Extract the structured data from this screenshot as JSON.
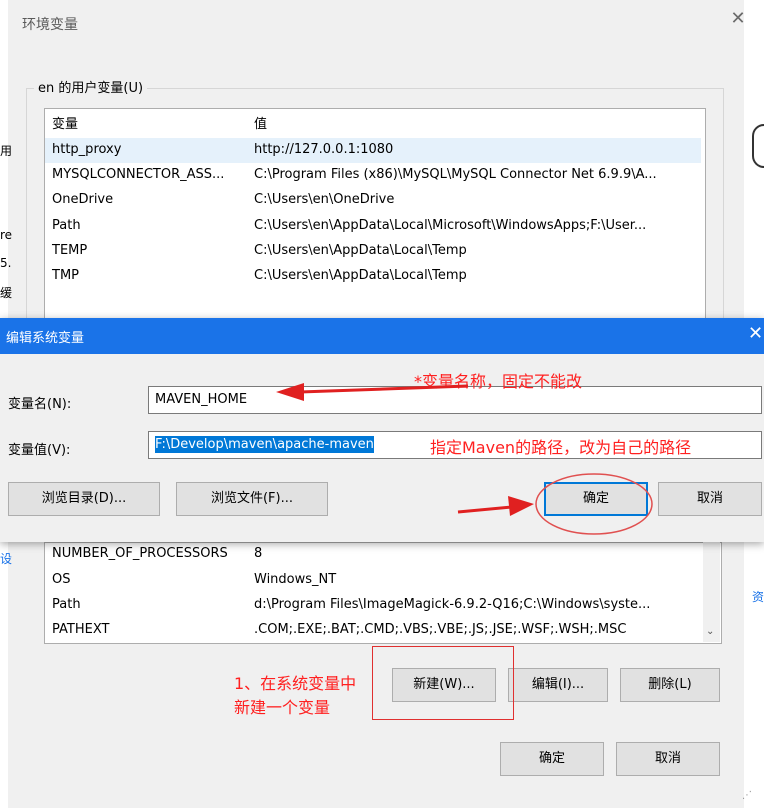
{
  "env_window": {
    "title": "环境变量",
    "user_group_label": "en 的用户变量(U)",
    "columns": [
      "变量",
      "值"
    ],
    "user_vars": [
      {
        "name": "http_proxy",
        "value": "http://127.0.0.1:1080"
      },
      {
        "name": "MYSQLCONNECTOR_ASS...",
        "value": "C:\\Program Files (x86)\\MySQL\\MySQL Connector Net 6.9.9\\A..."
      },
      {
        "name": "OneDrive",
        "value": "C:\\Users\\en\\OneDrive"
      },
      {
        "name": "Path",
        "value": "C:\\Users\\en\\AppData\\Local\\Microsoft\\WindowsApps;F:\\User..."
      },
      {
        "name": "TEMP",
        "value": "C:\\Users\\en\\AppData\\Local\\Temp"
      },
      {
        "name": "TMP",
        "value": "C:\\Users\\en\\AppData\\Local\\Temp"
      }
    ],
    "system_vars": [
      {
        "name": "NUMBER_OF_PROCESSORS",
        "value": "8"
      },
      {
        "name": "OS",
        "value": "Windows_NT"
      },
      {
        "name": "Path",
        "value": "d:\\Program Files\\ImageMagick-6.9.2-Q16;C:\\Windows\\syste..."
      },
      {
        "name": "PATHEXT",
        "value": ".COM;.EXE;.BAT;.CMD;.VBS;.VBE;.JS;.JSE;.WSF;.WSH;.MSC"
      }
    ],
    "btn_new": "新建(W)...",
    "btn_edit": "编辑(I)...",
    "btn_delete": "删除(L)",
    "btn_ok": "确定",
    "btn_cancel": "取消",
    "left_behind_glyphs": [
      "用",
      "re",
      "5.",
      "缓"
    ],
    "left_behind_glyph2": "设",
    "right_behind_glyph": "资"
  },
  "edit_dialog": {
    "title": "编辑系统变量",
    "name_label": "变量名(N):",
    "name_value": "MAVEN_HOME",
    "value_label": "变量值(V):",
    "value_value": "F:\\Develop\\maven\\apache-maven",
    "btn_browse_dir": "浏览目录(D)...",
    "btn_browse_file": "浏览文件(F)...",
    "btn_ok": "确定",
    "btn_cancel": "取消"
  },
  "annotations": {
    "name_note": "*变量名称，固定不能改",
    "value_note": "指定Maven的路径，改为自己的路径",
    "step_note_line1": "1、在系统变量中",
    "step_note_line2": "新建一个变量"
  },
  "colors": {
    "accent": "#1a73e8",
    "annotation": "#ff2020",
    "selection": "#e5f1fb"
  }
}
